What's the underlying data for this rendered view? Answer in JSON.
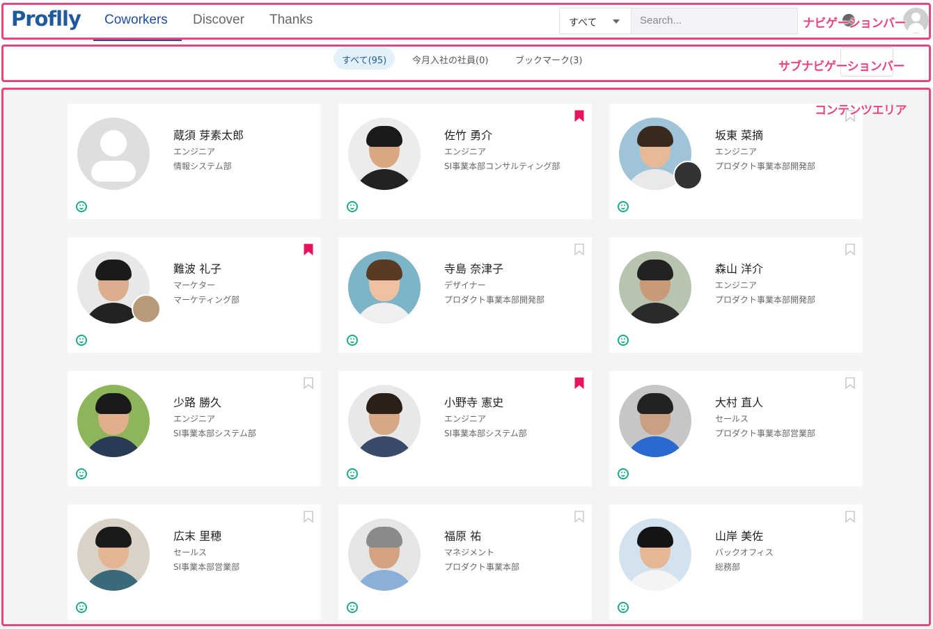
{
  "nav": {
    "logo": "Proflly",
    "tabs": [
      "Coworkers",
      "Discover",
      "Thanks"
    ],
    "scope": "すべて",
    "search_placeholder": "Search..."
  },
  "subnav": {
    "filters": [
      "すべて(95)",
      "今月入社の社員(0)",
      "ブックマーク(3)"
    ]
  },
  "annotations": {
    "nav": "ナビゲーションバー",
    "subnav": "サブナビゲーションバー",
    "content": "コンテンツエリア"
  },
  "colors": {
    "accent": "#1e4e9c",
    "annotation": "#e8457a",
    "bookmark_on": "#e6145e",
    "bookmark_off": "#cccccc",
    "smile": "#1aa98a"
  },
  "cards": [
    {
      "name": "蔵須 芽素太郎",
      "role": "エンジニア",
      "dept": "情報システム部",
      "bookmarked": false,
      "bookmark_visible": false,
      "photo": "placeholder"
    },
    {
      "name": "佐竹 勇介",
      "role": "エンジニア",
      "dept": "SI事業本部コンサルティング部",
      "bookmarked": true,
      "bookmark_visible": true,
      "photo": "man-short-hair"
    },
    {
      "name": "坂東 菜摘",
      "role": "エンジニア",
      "dept": "プロダクト事業本部開発部",
      "bookmarked": false,
      "bookmark_visible": true,
      "photo": "woman-short-hair"
    },
    {
      "name": "難波 礼子",
      "role": "マーケター",
      "dept": "マーケティング部",
      "bookmarked": true,
      "bookmark_visible": true,
      "photo": "woman-bob"
    },
    {
      "name": "寺島 奈津子",
      "role": "デザイナー",
      "dept": "プロダクト事業本部開発部",
      "bookmarked": false,
      "bookmark_visible": true,
      "photo": "woman-smile"
    },
    {
      "name": "森山 洋介",
      "role": "エンジニア",
      "dept": "プロダクト事業本部開発部",
      "bookmarked": false,
      "bookmark_visible": true,
      "photo": "man-beard"
    },
    {
      "name": "少路 勝久",
      "role": "エンジニア",
      "dept": "SI事業本部システム部",
      "bookmarked": false,
      "bookmark_visible": true,
      "photo": "man-young"
    },
    {
      "name": "小野寺 憲史",
      "role": "エンジニア",
      "dept": "SI事業本部システム部",
      "bookmarked": true,
      "bookmark_visible": true,
      "photo": "man-glasses"
    },
    {
      "name": "大村 直人",
      "role": "セールス",
      "dept": "プロダクト事業本部営業部",
      "bookmarked": false,
      "bookmark_visible": true,
      "photo": "man-glasses-beard"
    },
    {
      "name": "広末 里穂",
      "role": "セールス",
      "dept": "SI事業本部営業部",
      "bookmarked": false,
      "bookmark_visible": true,
      "photo": "woman-glasses"
    },
    {
      "name": "福原 祐",
      "role": "マネジメント",
      "dept": "プロダクト事業本部",
      "bookmarked": false,
      "bookmark_visible": true,
      "photo": "man-gray"
    },
    {
      "name": "山岸 美佐",
      "role": "バックオフィス",
      "dept": "総務部",
      "bookmarked": false,
      "bookmark_visible": true,
      "photo": "woman-dark-hair"
    }
  ]
}
